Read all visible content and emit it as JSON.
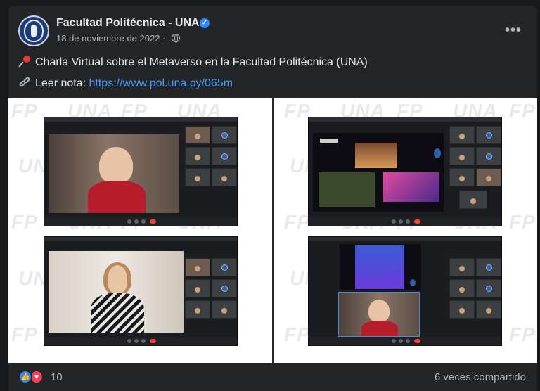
{
  "post": {
    "page_name": "Facultad Politécnica - UNA",
    "verified_icon": "verified-badge-icon",
    "date": "18 de noviembre de 2022 ·",
    "privacy_icon": "globe-icon",
    "menu_icon": "more-options-icon",
    "menu_label": "•••",
    "text_line1": "Charla Virtual sobre el Metaverso en la Facultad Politécnica (UNA)",
    "text_line2_prefix": "Leer nota: ",
    "link_url": "https://www.pol.una.py/065m",
    "watermark": "FP UNA"
  },
  "reactions": {
    "count": "10",
    "icons": [
      "like-icon",
      "love-icon"
    ],
    "shares": "6 veces compartido"
  },
  "colors": {
    "background": "#242526",
    "text": "#e4e6eb",
    "muted": "#b0b3b8",
    "link": "#4599ff",
    "like": "#2d88ff",
    "love": "#f33e58"
  }
}
